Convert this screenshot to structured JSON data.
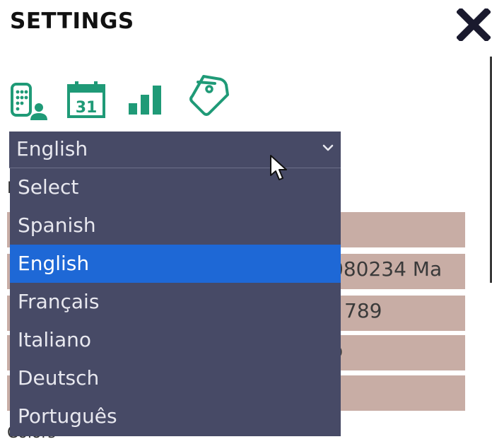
{
  "header": {
    "title": "SETTINGS",
    "close_icon": "close-icon"
  },
  "toolbar": {
    "icons": [
      "phone-user-icon",
      "calendar-icon",
      "bar-chart-icon",
      "tag-icon"
    ],
    "calendar_day": "31",
    "accent_color": "#1f9a77"
  },
  "language_select": {
    "selected_value": "English",
    "options": [
      {
        "label": "Select",
        "selected": false
      },
      {
        "label": "Spanish",
        "selected": false
      },
      {
        "label": "English",
        "selected": true
      },
      {
        "label": "Français",
        "selected": false
      },
      {
        "label": "Italiano",
        "selected": false
      },
      {
        "label": "Deutsch",
        "selected": false
      },
      {
        "label": "Português",
        "selected": false
      }
    ],
    "colors": {
      "background": "#474a66",
      "selected": "#1e68d6"
    }
  },
  "background_form": {
    "partial_values": [
      "080234 Ma",
      "- 789",
      "o"
    ],
    "colors_label": "Colors",
    "row_color": "#c8ada5"
  }
}
